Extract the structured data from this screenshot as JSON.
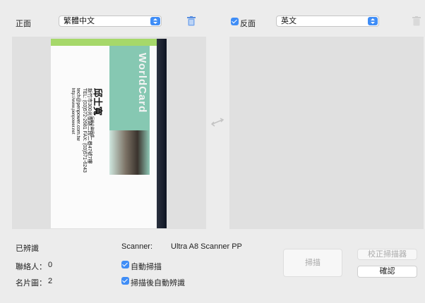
{
  "front": {
    "label": "正面",
    "language": "繁體中文"
  },
  "back": {
    "label": "反面",
    "language": "英文",
    "checked": true
  },
  "card": {
    "brand": "WorldCard",
    "name": "邱士寬",
    "title": "行銷企劃經理",
    "address": "新竹市300光復路二段二巷47號7樓",
    "tel": "TEL: (03)572-2681  FAX: (03)571-6243",
    "email": "tech@penpower.com.tw",
    "web": "http://www.penpower.net"
  },
  "stats": {
    "recognized_label": "已辨識",
    "contacts_label": "聯絡人：",
    "contacts_value": "0",
    "cards_label": "名片圖：",
    "cards_value": "2"
  },
  "scanner": {
    "label": "Scanner:",
    "name": "Ultra A8 Scanner PP",
    "auto_scan_label": "自動掃描",
    "auto_recognize_label": "掃描後自動辨識"
  },
  "buttons": {
    "scan": "掃描",
    "calibrate": "校正掃描器",
    "confirm": "確認"
  },
  "colors": {
    "accent": "#3f8df6",
    "card_green": "#a6d86a"
  }
}
